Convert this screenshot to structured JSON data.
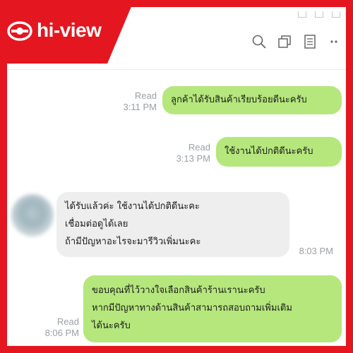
{
  "brand": {
    "name": "hi-view"
  },
  "toolbar": {
    "icons": [
      "search-icon",
      "copy-icon",
      "notes-icon",
      "more-icon"
    ]
  },
  "messages": [
    {
      "direction": "outgoing",
      "status": "Read",
      "time": "3:11 PM",
      "lines": [
        "ลูกค้าได้รับสินค้าเรียบร้อยดีนะครับ"
      ]
    },
    {
      "direction": "outgoing",
      "status": "Read",
      "time": "3:13 PM",
      "lines": [
        "ใช้งานได้ปกติดีนะครับ"
      ]
    },
    {
      "direction": "incoming",
      "time": "8:03 PM",
      "lines": [
        "ได้รับแล้วค่ะ ใช้งานได้ปกติดีนะคะ",
        "เชื่อมต่อดูได้เลย",
        "ถ้ามีปัญหาอะไรจะมารีวิวเพิ่มนะคะ"
      ]
    },
    {
      "direction": "outgoing",
      "status": "Read",
      "time": "8:06 PM",
      "lines": [
        "ขอบคุณที่ไว้วางใจเลือกสินค้าร้านเรานะครับ",
        "หากมีปัญหาทางด้านสินค้าสามารถสอบถามเพิ่มเติม",
        "ได้นะครับ"
      ]
    }
  ],
  "colors": {
    "brand_red": "#e4161f",
    "outgoing_bubble": "#b5e77c",
    "incoming_bubble": "#eeeeee",
    "meta_text": "#9aa0a6"
  }
}
